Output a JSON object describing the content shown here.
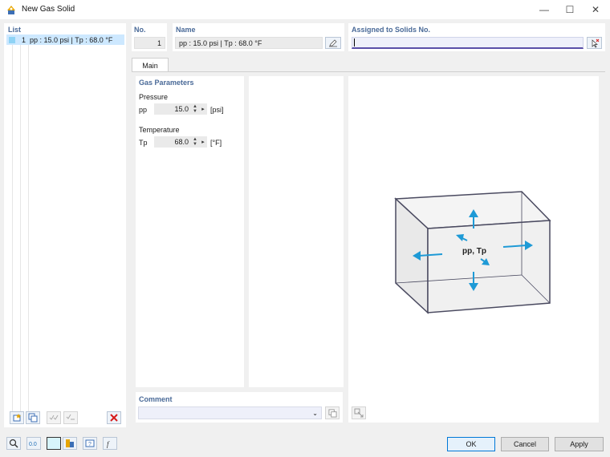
{
  "window": {
    "title": "New Gas Solid",
    "minimize": "—",
    "maximize": "☐",
    "close": "✕"
  },
  "list": {
    "header": "List",
    "items": [
      {
        "num": "1",
        "text": "pp : 15.0 psi | Tp : 68.0 °F"
      }
    ]
  },
  "no": {
    "label": "No.",
    "value": "1"
  },
  "name": {
    "label": "Name",
    "value": "pp : 15.0 psi | Tp : 68.0 °F"
  },
  "assigned": {
    "label": "Assigned to Solids No.",
    "value": ""
  },
  "tabs": [
    {
      "label": "Main"
    }
  ],
  "gas_params": {
    "title": "Gas Parameters",
    "pressure": {
      "label": "Pressure",
      "symbol": "pp",
      "value": "15.0",
      "unit": "[psi]"
    },
    "temperature": {
      "label": "Temperature",
      "symbol": "Tp",
      "value": "68.0",
      "unit": "[°F]"
    }
  },
  "diagram": {
    "label": "pp, Tp"
  },
  "comment": {
    "label": "Comment",
    "value": ""
  },
  "buttons": {
    "ok": "OK",
    "cancel": "Cancel",
    "apply": "Apply"
  },
  "colors": {
    "accent": "#1e9ad6",
    "section": "#4a6a98",
    "selection": "#cde8ff"
  }
}
